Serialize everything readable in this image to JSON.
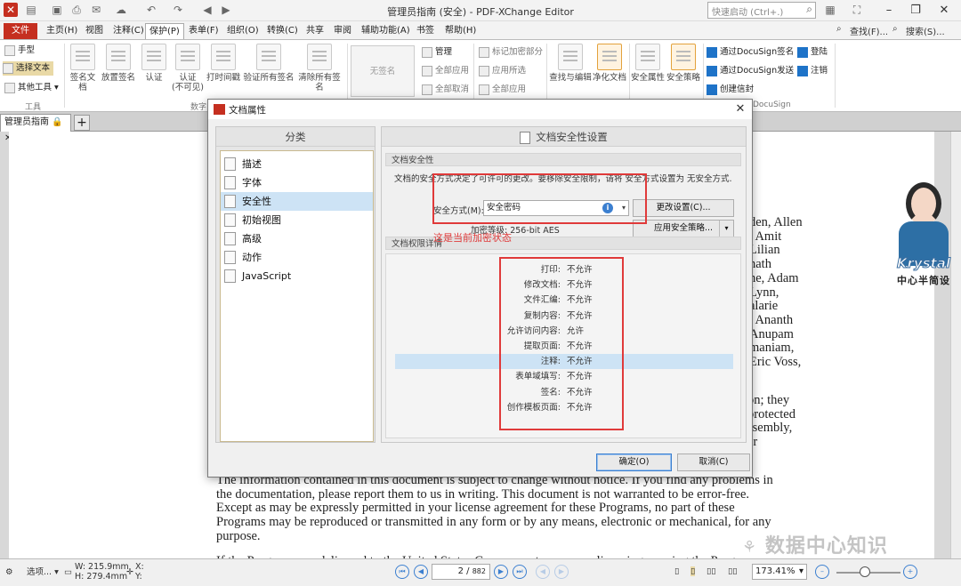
{
  "titlebar": {
    "title": "管理员指南 (安全) - PDF-XChange Editor",
    "quick_launch_placeholder": "快速启动 (Ctrl+.)"
  },
  "menubar": {
    "tabs": [
      "文件(F)",
      "主页(H)",
      "视图",
      "注释(C)",
      "保护(P)",
      "表单(F)",
      "组织(O)",
      "转换(C)",
      "共享",
      "审阅",
      "辅助功能(A)",
      "书签",
      "帮助(H)"
    ],
    "find": "查找(F)...",
    "search": "搜索(S)..."
  },
  "ribbon": {
    "tools": {
      "hand": "手型",
      "select_text": "选择文本",
      "other_tools": "其他工具",
      "group": "工具"
    },
    "digital": {
      "buttons": [
        "签名文档",
        "放置签名",
        "认证",
        "认证\n(不可见)",
        "打时间戳",
        "验证所有签名",
        "清除所有签名"
      ],
      "group": "数字"
    },
    "no_signature": "无签名",
    "manage": [
      "管理",
      "全部应用",
      "全部取消"
    ],
    "redact": [
      "标记加密部分",
      "应用所选",
      "全部应用"
    ],
    "find_edit": "查找与编辑",
    "sanitize": "净化文档",
    "sec_props": "安全属性",
    "sec_policy": "安全策略",
    "docusign": [
      "通过DocuSign签名",
      "通过DocuSign发送",
      "创建信封"
    ],
    "docusign_login": "登陆",
    "docusign_logout": "注销",
    "docusign_group": "DocuSign"
  },
  "doctab": {
    "name": "管理员指南"
  },
  "document": {
    "names_lines": [
      "den, Allen",
      ", Amit",
      "Lilian",
      "nath",
      "ne, Adam",
      "Lynn,",
      "alarie",
      ", Ananth",
      "Anupam",
      "maniam,",
      "Eric Voss,"
    ],
    "notes_lines": [
      "on; they",
      "protected",
      "ssembly,",
      "er"
    ],
    "para_lines": [
      "The information contained in this document is subject to change without notice. If you find any problems in",
      "the documentation, please report them to us in writing. This document is not warranted to be error-free.",
      "Except as may be expressly permitted in your license agreement for these Programs, no part of these",
      "Programs may be reproduced or transmitted in any form or by any means, electronic or mechanical, for any",
      "purpose."
    ],
    "last_line": "If the Programs are delivered to the United States Government or anyone licensing or using the Programs on"
  },
  "watermark": {
    "text": "数据中心知识",
    "avatar_name": "Krystal",
    "avatar_sub": "中心半简设"
  },
  "statusbar": {
    "options": "选项...",
    "width": "W: 215.9mm",
    "height": "H: 279.4mm",
    "x": "X:",
    "y": "Y:",
    "page": "2",
    "page_total": "882",
    "zoom": "173.41%"
  },
  "dialog": {
    "title": "文档属性",
    "category_header": "分类",
    "categories": [
      "描述",
      "字体",
      "安全性",
      "初始视图",
      "高级",
      "动作",
      "JavaScript"
    ],
    "selected_category": "安全性",
    "panel_title": "文档安全性设置",
    "security_section": "文档安全性",
    "security_desc": "文档的安全方式决定了可许可的更改。要移除安全限制，请将 安全方式设置为 无安全方式.",
    "method_label": "安全方式(M):",
    "method_value": "安全密码",
    "change_settings": "更改设置(C)...",
    "encryption_level": "加密等级: 256-bit AES",
    "apply_policy": "应用安全策略...",
    "annotation": "这是当前加密状态",
    "permissions_section": "文档权限详情",
    "permissions": [
      {
        "label": "打印:",
        "value": "不允许"
      },
      {
        "label": "修改文档:",
        "value": "不允许"
      },
      {
        "label": "文件汇编:",
        "value": "不允许"
      },
      {
        "label": "复制内容:",
        "value": "不允许"
      },
      {
        "label": "允许访问内容:",
        "value": "允许"
      },
      {
        "label": "提取页面:",
        "value": "不允许"
      },
      {
        "label": "注释:",
        "value": "不允许"
      },
      {
        "label": "表单域填写:",
        "value": "不允许"
      },
      {
        "label": "签名:",
        "value": "不允许"
      },
      {
        "label": "创作模板页面:",
        "value": "不允许"
      }
    ],
    "ok": "确定(O)",
    "cancel": "取消(C)"
  },
  "colors": {
    "accent_red": "#c52f20",
    "annotation_red": "#e03a3a",
    "selection_blue": "#cde3f5"
  }
}
